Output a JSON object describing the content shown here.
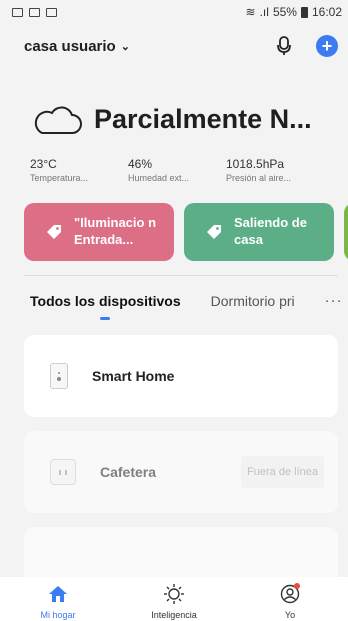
{
  "status_bar": {
    "battery": "55%",
    "time": "16:02"
  },
  "header": {
    "home_name": "casa usuario",
    "chevron": "⌄"
  },
  "weather": {
    "status": "Parcialmente N...",
    "stats": [
      {
        "value": "23°C",
        "label": "Temperatura..."
      },
      {
        "value": "46%",
        "label": "Humedad ext..."
      },
      {
        "value": "1018.5hPa",
        "label": "Presión al aire..."
      }
    ]
  },
  "scenes": [
    {
      "label": "\"Iluminacio n Entrada...",
      "color": "#dc6f86"
    },
    {
      "label": "Saliendo de casa",
      "color": "#5cae87"
    }
  ],
  "tabs": [
    {
      "label": "Todos los dispositivos"
    },
    {
      "label": "Dormitorio pri"
    }
  ],
  "more": "···",
  "devices": [
    {
      "name": "Smart Home",
      "icon": "smart-plug-icon",
      "status": ""
    },
    {
      "name": "Cafetera",
      "icon": "outlet-icon",
      "status": "Fuera de línea"
    }
  ],
  "bottom_nav": [
    {
      "label": "Mi hogar",
      "icon": "home-icon"
    },
    {
      "label": "Inteligencia",
      "icon": "sun-icon"
    },
    {
      "label": "Yo",
      "icon": "profile-icon"
    }
  ],
  "colors": {
    "accent": "#3b7cf5",
    "offline_text": "#999999"
  }
}
